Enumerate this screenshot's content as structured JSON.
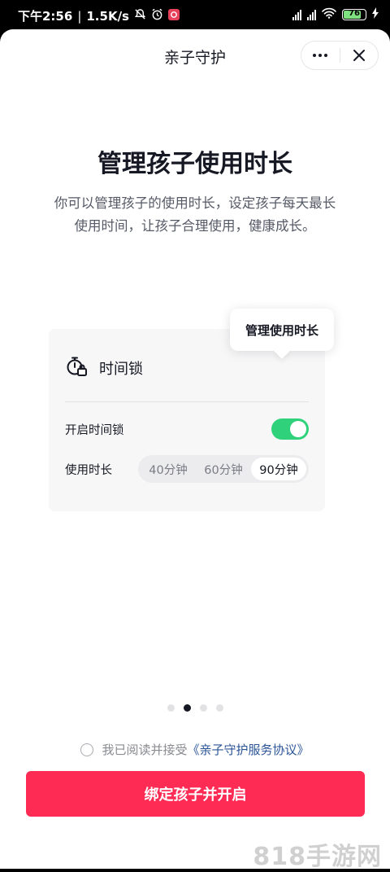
{
  "status_bar": {
    "time": "下午2:56",
    "speed": "1.5K/s",
    "battery": "76"
  },
  "nav": {
    "title": "亲子守护",
    "more_label": "···"
  },
  "headline": "管理孩子使用时长",
  "description_lines": [
    "你可以管理孩子的使用时长，设定孩子每天最长",
    "使用时间，让孩子合理使用，健康成长。"
  ],
  "tooltip": "管理使用时长",
  "card": {
    "title": "时间锁",
    "toggle_label": "开启时间锁",
    "toggle_on": true,
    "duration_label": "使用时长",
    "options": [
      "40分钟",
      "60分钟",
      "90分钟"
    ],
    "selected_option": "90分钟"
  },
  "pager": {
    "count": 4,
    "active_index": 1
  },
  "agreement": {
    "prefix": "我已阅读并接受",
    "link": "《亲子守护服务协议》"
  },
  "cta_label": "绑定孩子并开启",
  "watermark": "818手游网",
  "colors": {
    "accent": "#fe2c55",
    "toggle": "#2fd27a",
    "link": "#2b5597"
  }
}
